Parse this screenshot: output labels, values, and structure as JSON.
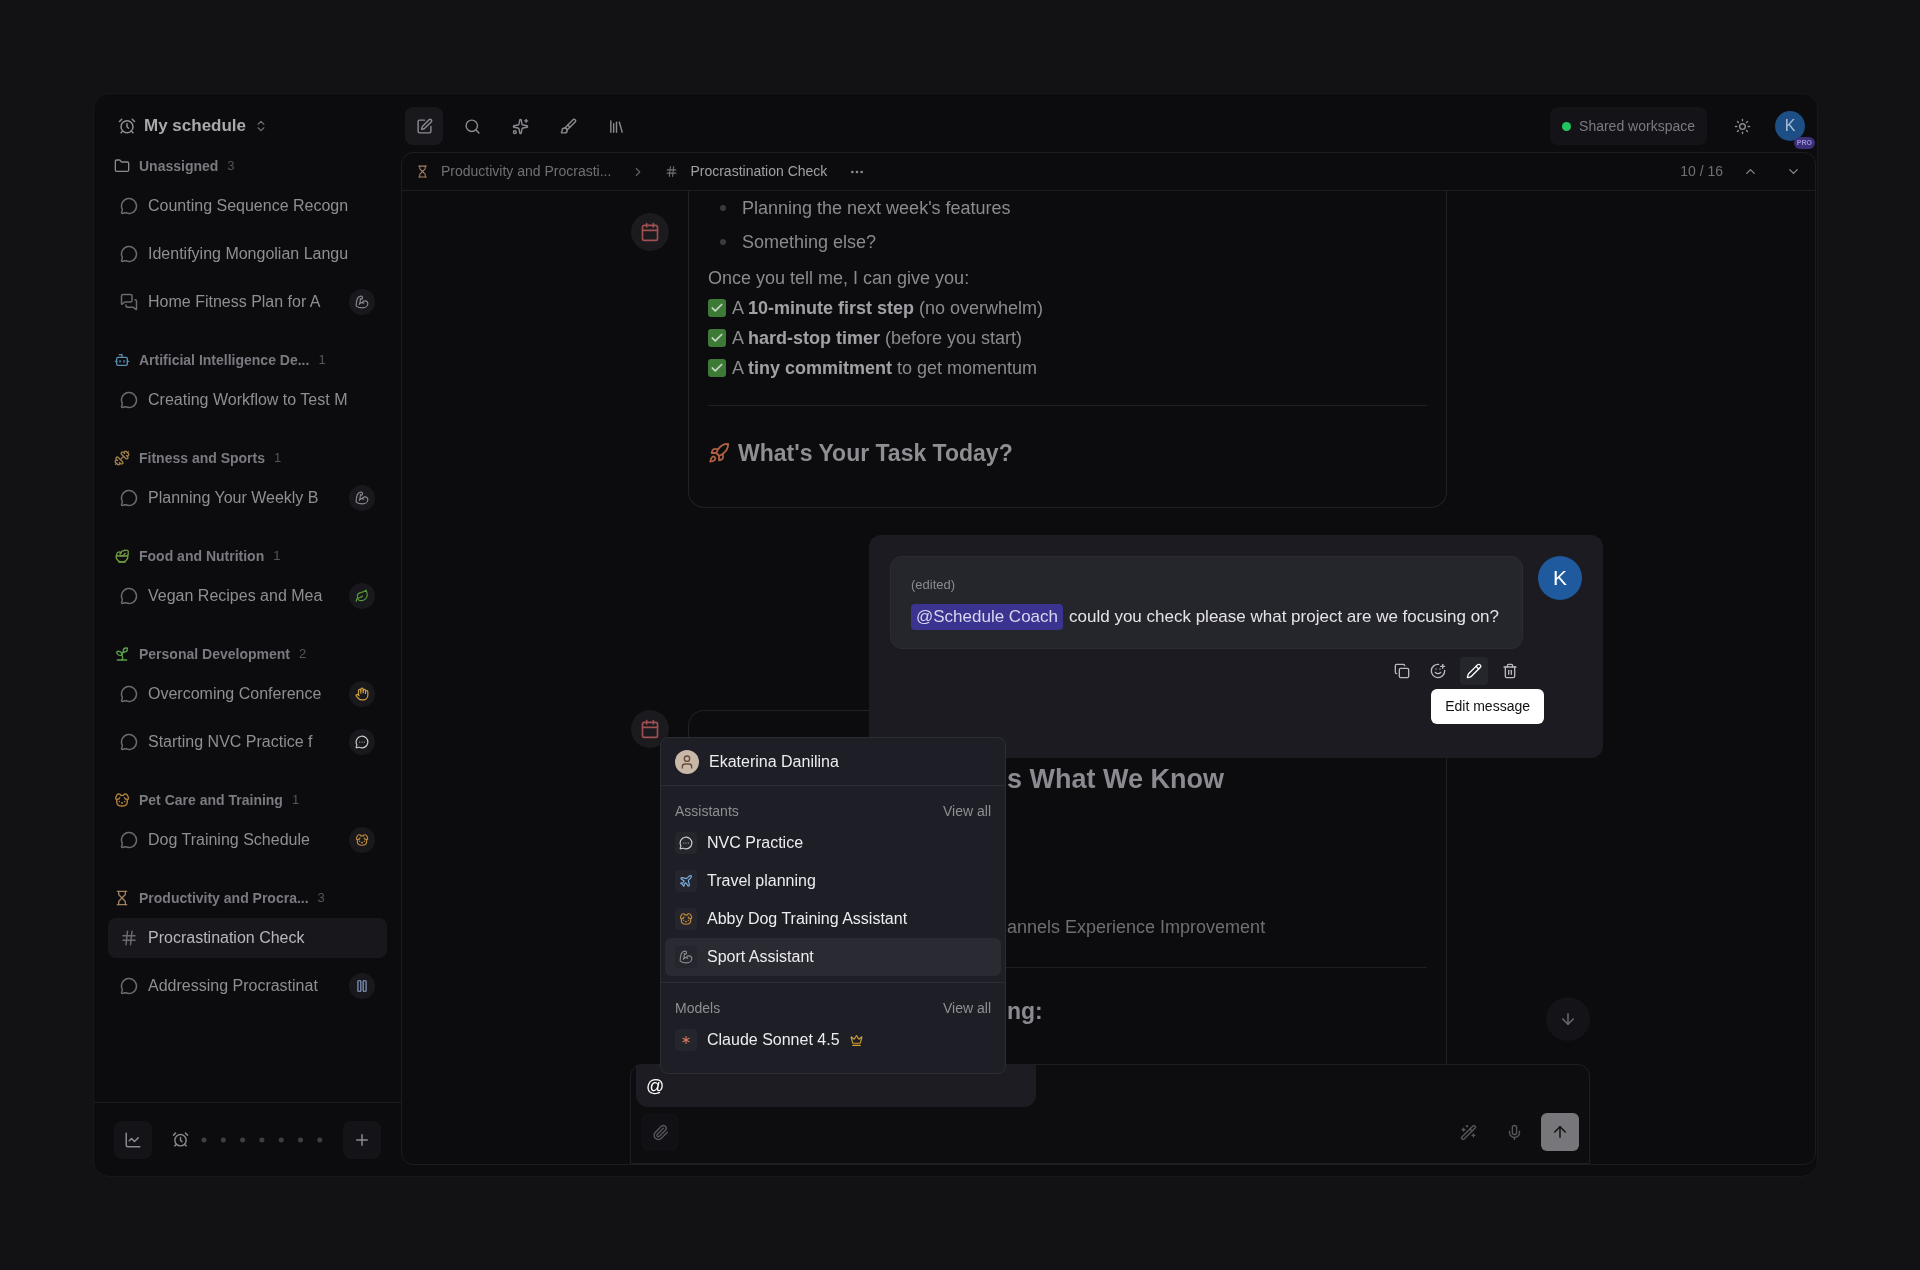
{
  "sidebar": {
    "title": "My schedule",
    "groups": [
      {
        "name": "Unassigned",
        "count": "3",
        "kind": "folder",
        "items": [
          {
            "label": "Counting Sequence Recogn",
            "kind": "chat",
            "selected": false
          },
          {
            "label": "Identifying Mongolian Langu",
            "kind": "chat",
            "selected": false
          },
          {
            "label": "Home Fitness Plan for A",
            "kind": "chats",
            "badge": {
              "kind": "arm"
            },
            "selected": false
          }
        ]
      },
      {
        "name": "Artificial Intelligence De...",
        "count": "1",
        "kind": "robot",
        "items": [
          {
            "label": "Creating Workflow to Test M",
            "kind": "chat",
            "selected": false
          }
        ]
      },
      {
        "name": "Fitness and Sports",
        "count": "1",
        "kind": "gym",
        "items": [
          {
            "label": "Planning Your Weekly B",
            "kind": "chat",
            "badge": {
              "kind": "arm"
            },
            "selected": false
          }
        ]
      },
      {
        "name": "Food and Nutrition",
        "count": "1",
        "kind": "salad",
        "items": [
          {
            "label": "Vegan Recipes and Mea",
            "kind": "chat",
            "badge": {
              "kind": "leaf"
            },
            "selected": false
          }
        ]
      },
      {
        "name": "Personal Development",
        "count": "2",
        "kind": "sprout",
        "items": [
          {
            "label": "Overcoming Conference",
            "kind": "chat",
            "badge": {
              "kind": "hand"
            },
            "selected": false
          },
          {
            "label": "Starting NVC Practice f",
            "kind": "chat",
            "badge": {
              "kind": "bubble"
            },
            "selected": false
          }
        ]
      },
      {
        "name": "Pet Care and Training",
        "count": "1",
        "kind": "dog",
        "items": [
          {
            "label": "Dog Training Schedule",
            "kind": "chat",
            "badge": {
              "kind": "dog"
            },
            "selected": false
          }
        ]
      },
      {
        "name": "Productivity and Procra...",
        "count": "3",
        "kind": "hourglass",
        "items": [
          {
            "label": "Procrastination Check",
            "kind": "hash",
            "selected": true
          },
          {
            "label": "Addressing Procrastinat",
            "kind": "chat",
            "badge": {
              "kind": "pause"
            },
            "selected": false
          }
        ]
      }
    ]
  },
  "header": {
    "workspace": "Shared workspace",
    "avatar": "K",
    "plan": "PRO"
  },
  "breadcrumb": {
    "items": [
      "Productivity and Procrasti...",
      "Procrastination Check"
    ],
    "position": "10 / 16"
  },
  "messages": [
    {
      "kind": "assistant",
      "bullets": [
        "Planning the next week's features",
        "Something else?"
      ],
      "intro": "Once you tell me, I can give you:",
      "checklist": [
        "A **10-minute first step** (no overwhelm)",
        "A **hard-stop timer** (before you start)",
        "A **tiny commitment** to get momentum"
      ],
      "heading": "What's Your Task Today?"
    },
    {
      "kind": "user",
      "note": "(edited)",
      "mention": "@Schedule Coach",
      "text": "could you check please what project are we focusing on?",
      "avatar": "K",
      "tooltip": "Edit message"
    },
    {
      "kind": "assistant_partial",
      "heading": "s What We Know",
      "line": "annels Experience Improvement",
      "subheading": "ng:"
    }
  ],
  "mention_menu": {
    "person": "Ekaterina Danilina",
    "sections": [
      {
        "title": "Assistants",
        "link": "View all",
        "items": [
          {
            "label": "NVC Practice",
            "kind": "bubble",
            "selected": false
          },
          {
            "label": "Travel planning",
            "kind": "plane",
            "selected": false
          },
          {
            "label": "Abby Dog Training Assistant",
            "kind": "dog",
            "selected": false
          },
          {
            "label": "Sport Assistant",
            "kind": "arm",
            "selected": true
          }
        ]
      },
      {
        "title": "Models",
        "link": "View all",
        "items": [
          {
            "label": "Claude Sonnet 4.5",
            "kind": "spark",
            "premium": true,
            "selected": false
          }
        ]
      }
    ]
  },
  "composer": {
    "value": "@"
  }
}
